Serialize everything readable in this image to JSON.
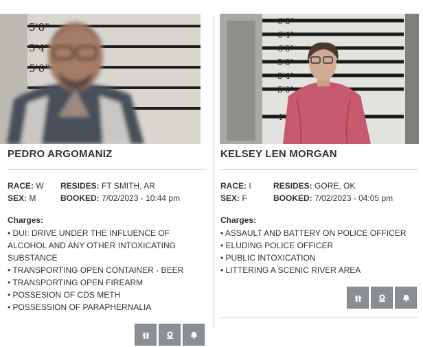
{
  "records": [
    {
      "name": "PEDRO ARGOMANIZ",
      "race_label": "RACE:",
      "race": "W",
      "resides_label": "RESIDES:",
      "resides": "FT SMITH, AR",
      "sex_label": "SEX:",
      "sex": "M",
      "booked_label": "BOOKED:",
      "booked": "7/02/2023 - 10:44 pm",
      "charges_label": "Charges:",
      "charges": [
        "• DUI: DRIVE UNDER THE INFLUENCE OF ALCOHOL AND ANY OTHER INTOXICATING SUBSTANCE",
        "• TRANSPORTING OPEN CONTAINER - BEER",
        "• TRANSPORTING OPEN FIREARM",
        "• POSSESION OF CDS METH",
        "• POSSESSION OF PARAPHERNALIA"
      ],
      "buttons": [
        "gift-icon",
        "badge-icon",
        "bell-icon"
      ]
    },
    {
      "name": "KELSEY LEN MORGAN",
      "race_label": "RACE:",
      "race": "I",
      "resides_label": "RESIDES:",
      "resides": "GORE, OK",
      "sex_label": "SEX:",
      "sex": "F",
      "booked_label": "BOOKED:",
      "booked": "7/02/2023 - 04:05 pm",
      "charges_label": "Charges:",
      "charges": [
        "• ASSAULT AND BATTERY ON POLICE OFFICER",
        "• ELUDING POLICE OFFICER",
        "• PUBLIC INTOXICATION",
        "• LITTERING A SCENIC RIVER AREA"
      ],
      "buttons": [
        "gift-icon",
        "badge-icon",
        "bell-icon"
      ]
    }
  ],
  "height_chart_marks": {
    "left": [
      "5'8\"",
      "5'4\"",
      "5'0\""
    ],
    "right": [
      "6'8\"",
      "6'4\"",
      "6'0\"",
      "5'8\"",
      "5'4\"",
      "5'0\"",
      "4'4\""
    ]
  },
  "colors": {
    "button_bg": "#8a8f94",
    "shirt_pink": "#c45a6c",
    "wall": "#e7e7e4"
  }
}
